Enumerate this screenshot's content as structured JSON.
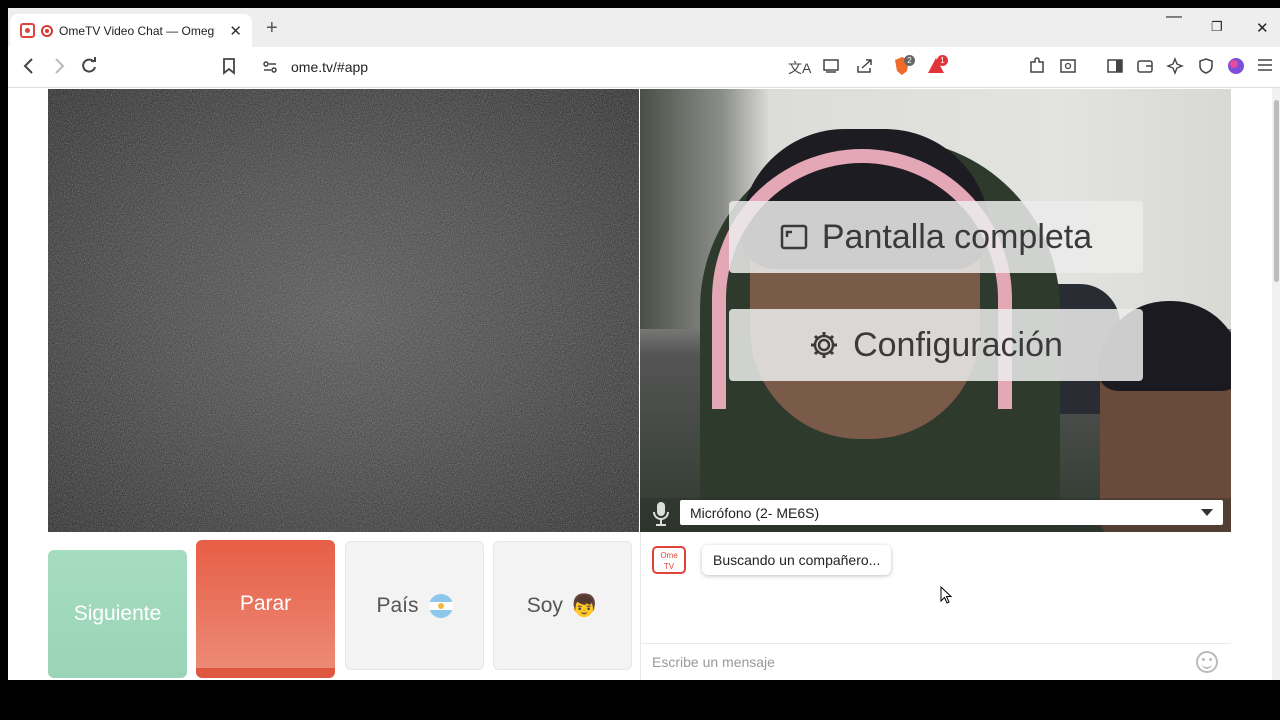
{
  "browser": {
    "tab_title": "OmeTV Video Chat — Omegle",
    "new_tab_symbol": "+",
    "url": "ome.tv/#app",
    "extensions_badges": [
      "2",
      "1"
    ],
    "icons": [
      "back-icon",
      "forward-icon",
      "reload-icon",
      "bookmark-icon",
      "site-settings-icon",
      "translate-icon",
      "cast-icon",
      "share-icon",
      "brave-shields-icon",
      "brave-rewards-icon",
      "extensions-icon",
      "tab-search-icon",
      "sidebar-icon",
      "wallet-icon",
      "leo-ai-icon",
      "vpn-icon",
      "profile-icon",
      "menu-icon"
    ]
  },
  "window": {
    "minimize": "—",
    "restore": "❐",
    "close": "✕"
  },
  "video": {
    "fullscreen_label": "Pantalla completa",
    "settings_label": "Configuración"
  },
  "microphone": {
    "selected": "Micrófono (2- ME6S)"
  },
  "controls": {
    "next_label": "Siguiente",
    "stop_label": "Parar",
    "country_label": "País",
    "me_label": "Soy"
  },
  "chat": {
    "logo_line1": "Ome",
    "logo_line2": "TV",
    "status_message": "Buscando un compañero...",
    "input_placeholder": "Escribe un mensaje"
  },
  "colors": {
    "next": "#9fd8bb",
    "stop": "#e8644b",
    "brand": "#e0443a"
  }
}
